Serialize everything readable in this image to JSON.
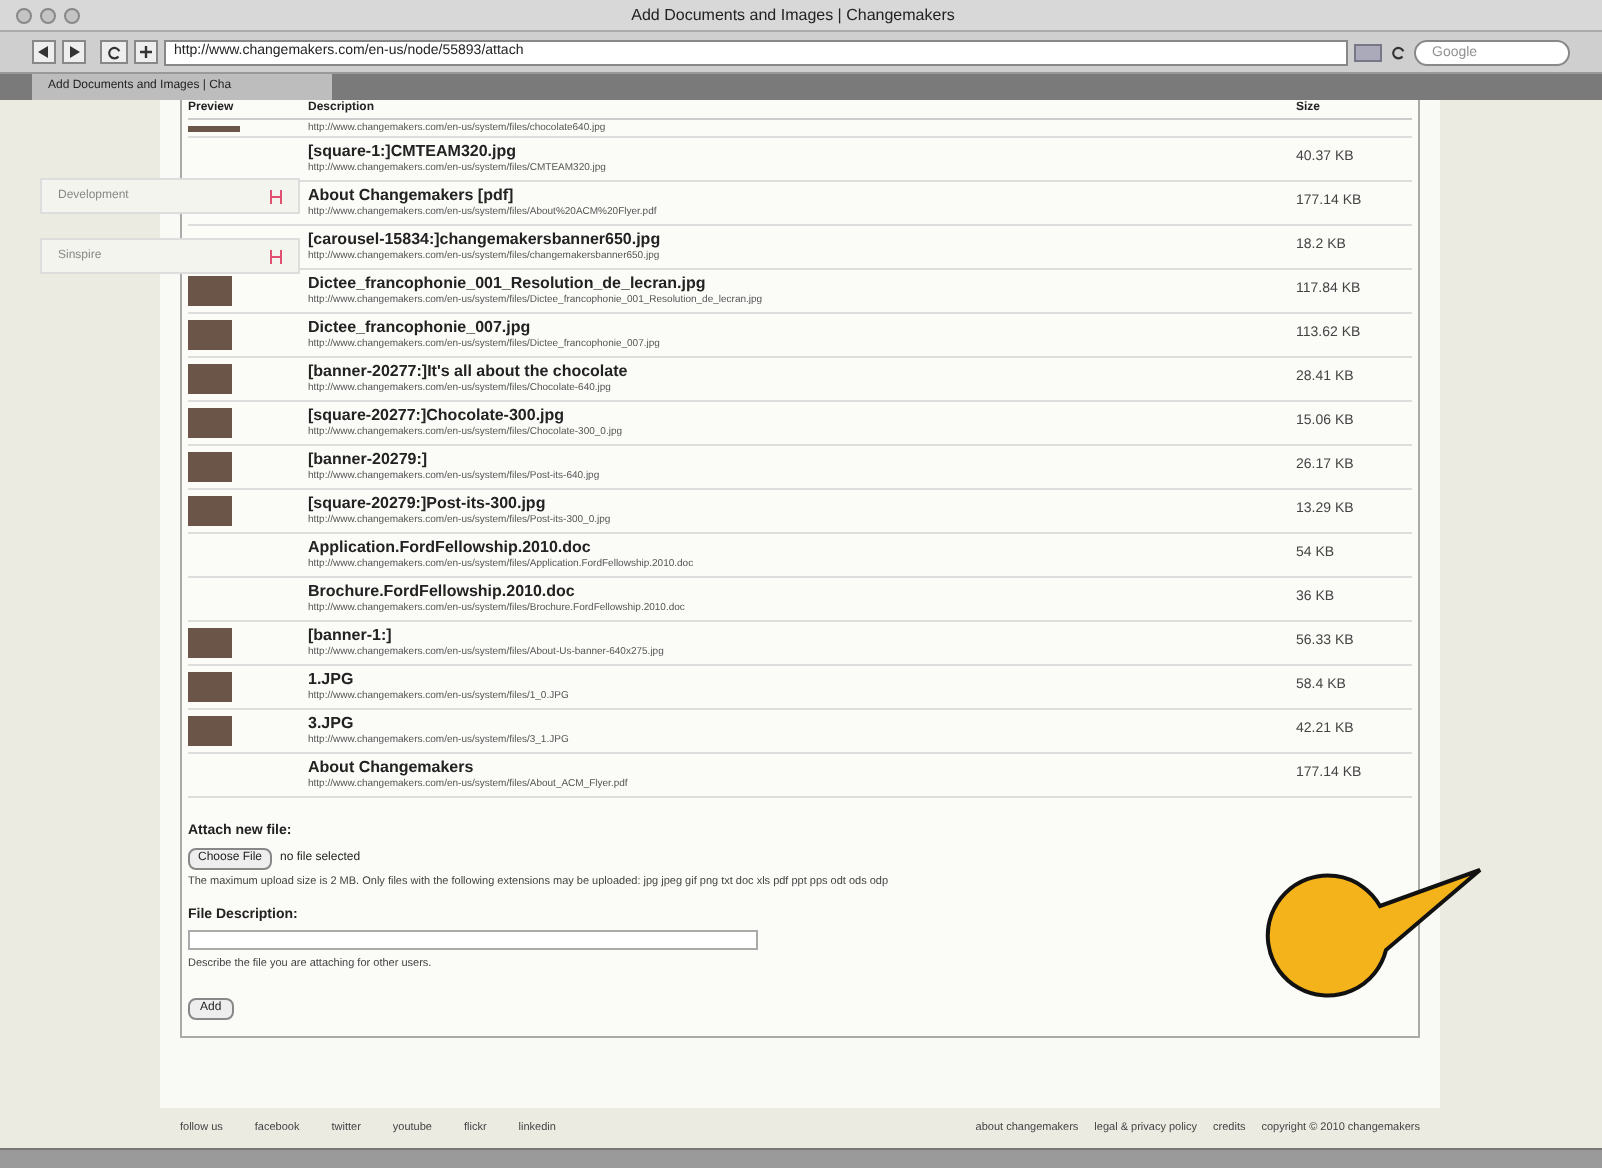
{
  "window": {
    "title": "Add Documents and Images | Changemakers"
  },
  "toolbar": {
    "url": "http://www.changemakers.com/en-us/node/55893/attach",
    "search_placeholder": "Google"
  },
  "tabs": [
    {
      "label": "Add Documents and Images | Cha",
      "selected": true
    }
  ],
  "sidebar": {
    "items": [
      {
        "label": "Development"
      },
      {
        "label": "Sinspire"
      }
    ]
  },
  "table": {
    "columns": [
      "Preview",
      "Description",
      "Size"
    ],
    "rows": [
      {
        "thumbnail": true,
        "url": "http://www.changemakers.com/en-us/system/files/chocolate640.jpg"
      },
      {
        "thumbnail": false,
        "title": "[square-1:]CMTEAM320.jpg",
        "url": "http://www.changemakers.com/en-us/system/files/CMTEAM320.jpg",
        "size": "40.37 KB"
      },
      {
        "thumbnail": false,
        "title": "About Changemakers [pdf]",
        "url": "http://www.changemakers.com/en-us/system/files/About%20ACM%20Flyer.pdf",
        "size": "177.14 KB"
      },
      {
        "thumbnail": false,
        "title": "[carousel-15834:]changemakersbanner650.jpg",
        "url": "http://www.changemakers.com/en-us/system/files/changemakersbanner650.jpg",
        "size": "18.2 KB"
      },
      {
        "thumbnail": true,
        "title": "Dictee_francophonie_001_Resolution_de_lecran.jpg",
        "url": "http://www.changemakers.com/en-us/system/files/Dictee_francophonie_001_Resolution_de_lecran.jpg",
        "size": "117.84 KB"
      },
      {
        "thumbnail": true,
        "title": "Dictee_francophonie_007.jpg",
        "url": "http://www.changemakers.com/en-us/system/files/Dictee_francophonie_007.jpg",
        "size": "113.62 KB"
      },
      {
        "thumbnail": true,
        "title": "[banner-20277:]It's all about the chocolate",
        "url": "http://www.changemakers.com/en-us/system/files/Chocolate-640.jpg",
        "size": "28.41 KB"
      },
      {
        "thumbnail": true,
        "title": "[square-20277:]Chocolate-300.jpg",
        "url": "http://www.changemakers.com/en-us/system/files/Chocolate-300_0.jpg",
        "size": "15.06 KB"
      },
      {
        "thumbnail": true,
        "title": "[banner-20279:]",
        "url": "http://www.changemakers.com/en-us/system/files/Post-its-640.jpg",
        "size": "26.17 KB"
      },
      {
        "thumbnail": true,
        "title": "[square-20279:]Post-its-300.jpg",
        "url": "http://www.changemakers.com/en-us/system/files/Post-its-300_0.jpg",
        "size": "13.29 KB"
      },
      {
        "thumbnail": false,
        "title": "Application.FordFellowship.2010.doc",
        "url": "http://www.changemakers.com/en-us/system/files/Application.FordFellowship.2010.doc",
        "size": "54 KB"
      },
      {
        "thumbnail": false,
        "title": "Brochure.FordFellowship.2010.doc",
        "url": "http://www.changemakers.com/en-us/system/files/Brochure.FordFellowship.2010.doc",
        "size": "36 KB"
      },
      {
        "thumbnail": true,
        "title": "[banner-1:]",
        "url": "http://www.changemakers.com/en-us/system/files/About-Us-banner-640x275.jpg",
        "size": "56.33 KB"
      },
      {
        "thumbnail": true,
        "title": "1.JPG",
        "url": "http://www.changemakers.com/en-us/system/files/1_0.JPG",
        "size": "58.4 KB"
      },
      {
        "thumbnail": true,
        "title": "3.JPG",
        "url": "http://www.changemakers.com/en-us/system/files/3_1.JPG",
        "size": "42.21 KB"
      },
      {
        "thumbnail": false,
        "title": "About Changemakers",
        "url": "http://www.changemakers.com/en-us/system/files/About_ACM_Flyer.pdf",
        "size": "177.14 KB"
      }
    ]
  },
  "attach": {
    "label": "Attach new file:",
    "button": "Choose File",
    "status": "no file selected",
    "help": "The maximum upload size is 2 MB. Only files with the following extensions may be uploaded: jpg jpeg gif png txt doc xls pdf ppt pps odt ods odp"
  },
  "description": {
    "label": "File Description:",
    "help": "Describe the file you are attaching for other users."
  },
  "submit": "Add",
  "footer": {
    "left": [
      "follow us",
      "facebook",
      "twitter",
      "youtube",
      "flickr",
      "linkedin"
    ],
    "right": [
      "about changemakers",
      "legal & privacy policy",
      "credits",
      "copyright © 2010 changemakers"
    ]
  }
}
